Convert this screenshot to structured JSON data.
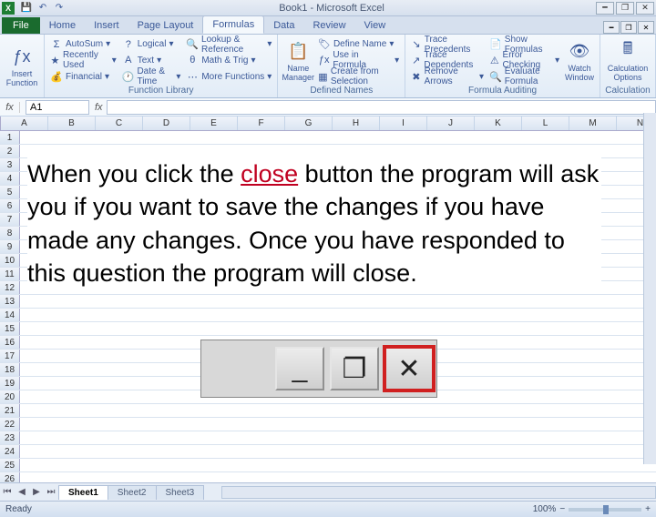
{
  "titlebar": {
    "app_title": "Book1 - Microsoft Excel",
    "excel_glyph": "X"
  },
  "tabs": {
    "file": "File",
    "items": [
      "Home",
      "Insert",
      "Page Layout",
      "Formulas",
      "Data",
      "Review",
      "View"
    ],
    "active": "Formulas"
  },
  "ribbon": {
    "insert_function": "Insert Function",
    "autosum": "AutoSum",
    "recently_used": "Recently Used",
    "financial": "Financial",
    "logical": "Logical",
    "text": "Text",
    "date_time": "Date & Time",
    "lookup_reference": "Lookup & Reference",
    "math_trig": "Math & Trig",
    "more_functions": "More Functions",
    "group_function_library": "Function Library",
    "name_manager": "Name Manager",
    "define_name": "Define Name",
    "use_in_formula": "Use in Formula",
    "create_from_selection": "Create from Selection",
    "group_defined_names": "Defined Names",
    "trace_precedents": "Trace Precedents",
    "trace_dependents": "Trace Dependents",
    "remove_arrows": "Remove Arrows",
    "show_formulas": "Show Formulas",
    "error_checking": "Error Checking",
    "evaluate_formula": "Evaluate Formula",
    "watch_window": "Watch Window",
    "group_formula_auditing": "Formula Auditing",
    "calculation_options": "Calculation Options",
    "group_calculation": "Calculation"
  },
  "formula_bar": {
    "fx": "fx",
    "name_box": "A1"
  },
  "columns": [
    "A",
    "B",
    "C",
    "D",
    "E",
    "F",
    "G",
    "H",
    "I",
    "J",
    "K",
    "L",
    "M",
    "N"
  ],
  "rows": [
    1,
    2,
    3,
    4,
    5,
    6,
    7,
    8,
    9,
    10,
    11,
    12,
    13,
    14,
    15,
    16,
    17,
    18,
    19,
    20,
    21,
    22,
    23,
    24,
    25,
    26
  ],
  "overlay": {
    "pre": "When you click the ",
    "close_word": "close",
    "post": " button the program will ask you if you want to save the changes if you have made any changes. Once you have responded to this question the program will close."
  },
  "demo_buttons": {
    "minimize": "_",
    "restore": "❐",
    "close": "✕"
  },
  "sheet_tabs": {
    "items": [
      "Sheet1",
      "Sheet2",
      "Sheet3"
    ],
    "active": "Sheet1"
  },
  "statusbar": {
    "ready": "Ready",
    "zoom": "100%"
  }
}
